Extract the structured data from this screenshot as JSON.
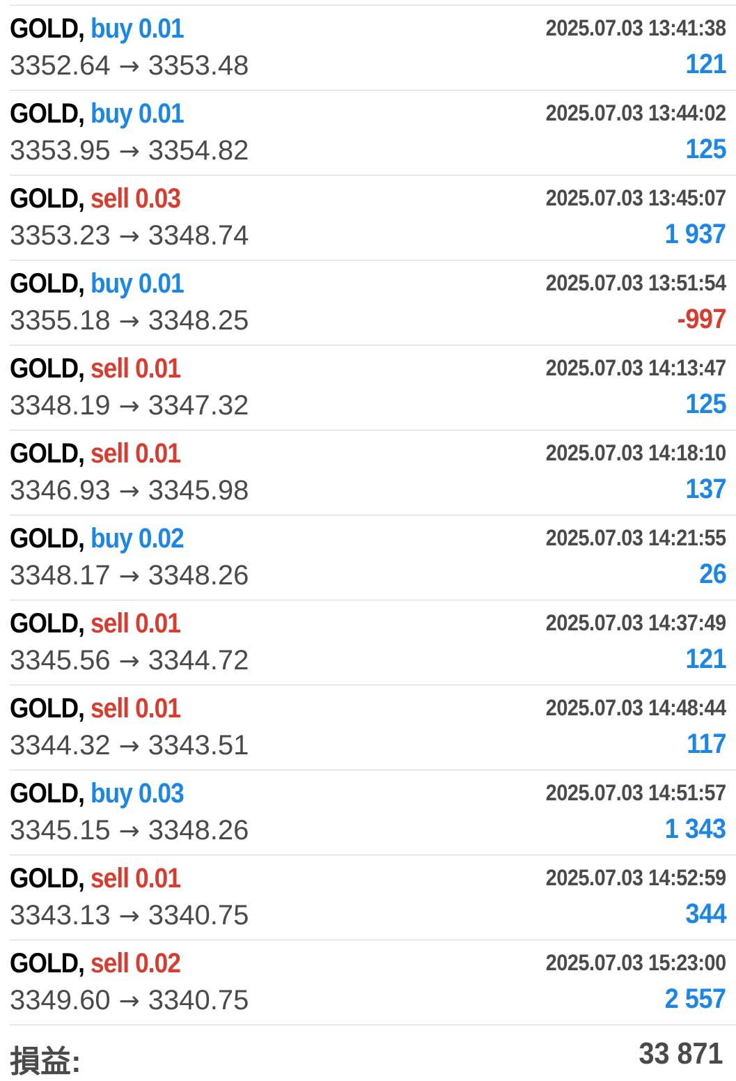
{
  "trades": [
    {
      "symbol": "GOLD,",
      "side": "buy",
      "side_label": "buy 0.01",
      "time": "2025.07.03 13:41:38",
      "open": "3352.64",
      "close": "3353.48",
      "profit": "121",
      "profit_sign": "pos"
    },
    {
      "symbol": "GOLD,",
      "side": "buy",
      "side_label": "buy 0.01",
      "time": "2025.07.03 13:44:02",
      "open": "3353.95",
      "close": "3354.82",
      "profit": "125",
      "profit_sign": "pos"
    },
    {
      "symbol": "GOLD,",
      "side": "sell",
      "side_label": "sell 0.03",
      "time": "2025.07.03 13:45:07",
      "open": "3353.23",
      "close": "3348.74",
      "profit": "1 937",
      "profit_sign": "pos"
    },
    {
      "symbol": "GOLD,",
      "side": "buy",
      "side_label": "buy 0.01",
      "time": "2025.07.03 13:51:54",
      "open": "3355.18",
      "close": "3348.25",
      "profit": "-997",
      "profit_sign": "neg"
    },
    {
      "symbol": "GOLD,",
      "side": "sell",
      "side_label": "sell 0.01",
      "time": "2025.07.03 14:13:47",
      "open": "3348.19",
      "close": "3347.32",
      "profit": "125",
      "profit_sign": "pos"
    },
    {
      "symbol": "GOLD,",
      "side": "sell",
      "side_label": "sell 0.01",
      "time": "2025.07.03 14:18:10",
      "open": "3346.93",
      "close": "3345.98",
      "profit": "137",
      "profit_sign": "pos"
    },
    {
      "symbol": "GOLD,",
      "side": "buy",
      "side_label": "buy 0.02",
      "time": "2025.07.03 14:21:55",
      "open": "3348.17",
      "close": "3348.26",
      "profit": "26",
      "profit_sign": "pos"
    },
    {
      "symbol": "GOLD,",
      "side": "sell",
      "side_label": "sell 0.01",
      "time": "2025.07.03 14:37:49",
      "open": "3345.56",
      "close": "3344.72",
      "profit": "121",
      "profit_sign": "pos"
    },
    {
      "symbol": "GOLD,",
      "side": "sell",
      "side_label": "sell 0.01",
      "time": "2025.07.03 14:48:44",
      "open": "3344.32",
      "close": "3343.51",
      "profit": "117",
      "profit_sign": "pos"
    },
    {
      "symbol": "GOLD,",
      "side": "buy",
      "side_label": "buy 0.03",
      "time": "2025.07.03 14:51:57",
      "open": "3345.15",
      "close": "3348.26",
      "profit": "1 343",
      "profit_sign": "pos"
    },
    {
      "symbol": "GOLD,",
      "side": "sell",
      "side_label": "sell 0.01",
      "time": "2025.07.03 14:52:59",
      "open": "3343.13",
      "close": "3340.75",
      "profit": "344",
      "profit_sign": "pos"
    },
    {
      "symbol": "GOLD,",
      "side": "sell",
      "side_label": "sell 0.02",
      "time": "2025.07.03 15:23:00",
      "open": "3349.60",
      "close": "3340.75",
      "profit": "2 557",
      "profit_sign": "pos"
    }
  ],
  "arrow": "→",
  "summary": {
    "label": "損益:",
    "value": "33 871"
  },
  "colors": {
    "buy": "#1a86e8",
    "sell": "#d93b2e",
    "profit_positive": "#1a86e8",
    "profit_negative": "#d93b2e",
    "text_gray": "#4a4a4a",
    "divider": "#d6d6d6"
  }
}
